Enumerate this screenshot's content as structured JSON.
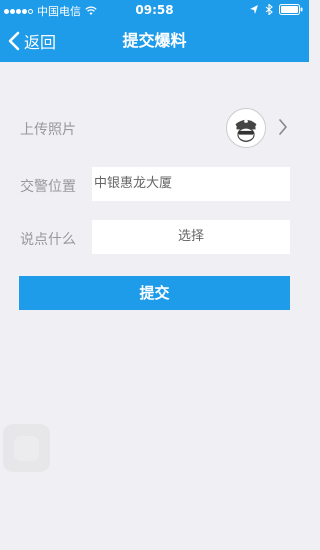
{
  "status_bar": {
    "carrier": "中国电信",
    "time": "09:58"
  },
  "nav": {
    "back_label": "返回",
    "title": "提交爆料"
  },
  "form": {
    "photo_label": "上传照片",
    "location_label": "交警位置",
    "location_value": "中银惠龙大厦",
    "comment_label": "说点什么",
    "comment_value": "选择"
  },
  "submit_label": "提交",
  "colors": {
    "accent": "#1e9be9",
    "background": "#efeff4"
  }
}
